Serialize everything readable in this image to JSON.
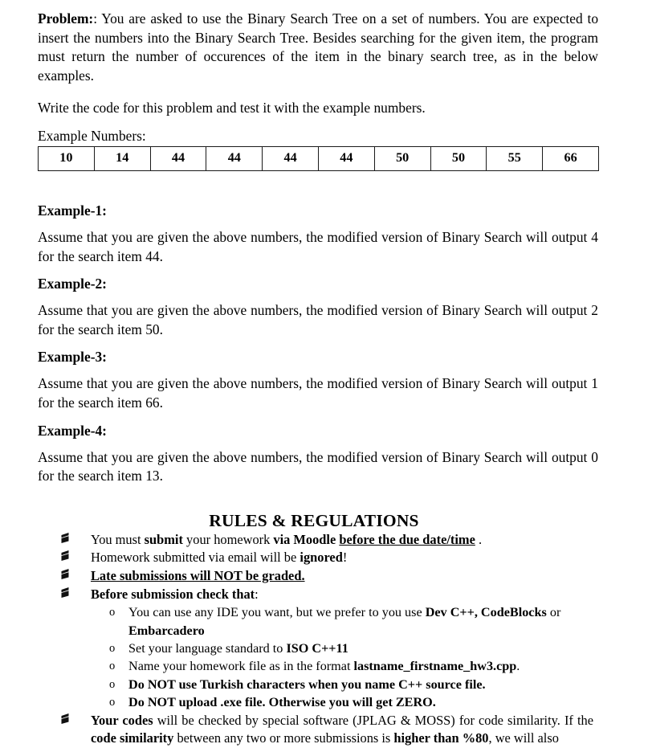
{
  "document": {
    "problem": {
      "label": "Problem:",
      "colon": ":",
      "text": "You are asked to use the Binary Search Tree on a set of numbers. You are expected to insert the numbers into the Binary Search Tree. Besides searching for the given item, the program must return the number of occurences of the item in the binary search tree, as in the below examples."
    },
    "instruction": "Write the code for this problem and test it with the example numbers.",
    "table_label": "Example Numbers:",
    "numbers": [
      "10",
      "14",
      "44",
      "44",
      "44",
      "44",
      "50",
      "50",
      "55",
      "66"
    ],
    "examples": [
      {
        "heading": "Example-1:",
        "body_pre": "Assume that you are given the above numbers, the modified version of Binary Search will output ",
        "output": "4",
        "body_mid": " for the search item ",
        "item": "44",
        "body_end": "."
      },
      {
        "heading": "Example-2:",
        "body_pre": "Assume that you are given the above numbers, the modified version of Binary Search will output ",
        "output": "2",
        "body_mid": " for the search item ",
        "item": "50",
        "body_end": "."
      },
      {
        "heading": "Example-3:",
        "body_pre": "Assume that you are given the above numbers, the modified version of Binary Search will output ",
        "output": "1",
        "body_mid": " for the search item ",
        "item": "66",
        "body_end": "."
      },
      {
        "heading": "Example-4:",
        "body_pre": "Assume that you are given the above numbers, the modified version of Binary Search will output ",
        "output": "0",
        "body_mid": " for the search item ",
        "item": "13",
        "body_end": "."
      }
    ],
    "rules": {
      "title": "RULES & REGULATIONS",
      "bullet_icon": "flag-marker-icon",
      "sub_marker": "o",
      "items": [
        {
          "seg1": "You must ",
          "bold1": "submit",
          "seg2": " your homework ",
          "bold2": "via Moodle",
          "seg3": " ",
          "boldunderline": "before the due date/time",
          "seg4": " ."
        },
        {
          "seg1": "Homework submitted via email will be ",
          "bold1": "ignored",
          "seg2": "!"
        },
        {
          "boldunderline": "Late submissions will NOT be graded."
        },
        {
          "bold1": "Before submission check that",
          "seg2": ":"
        }
      ],
      "sub_items": [
        {
          "seg1": "You can use any IDE you want, but we prefer to you use ",
          "bold1": "Dev C++, CodeBlocks",
          "seg2": " or ",
          "bold2": "Embarcadero",
          "seg3": ""
        },
        {
          "seg1": "Set your language standard to ",
          "bold1": "ISO C++11",
          "seg2": ""
        },
        {
          "seg1": "Name your homework file as in the format ",
          "bold1": "lastname_firstname_hw3.cpp",
          "seg2": "."
        },
        {
          "bold1": "Do NOT use Turkish characters when you name C++ source file.",
          "seg2": ""
        },
        {
          "bold1": "Do NOT upload .exe file. Otherwise you will get ZERO.",
          "seg2": ""
        }
      ],
      "final_item": {
        "bold1": "Your codes",
        "seg2": " will be checked by special software (JPLAG & MOSS) for code similarity. If the ",
        "bold2": "code similarity",
        "seg3": " between any two or more submissions is ",
        "bold3": "higher than %80",
        "seg4": ", we will also"
      }
    }
  },
  "colors": {
    "text": "#000000",
    "background": "#ffffff",
    "table_border": "#1a1a1a"
  }
}
